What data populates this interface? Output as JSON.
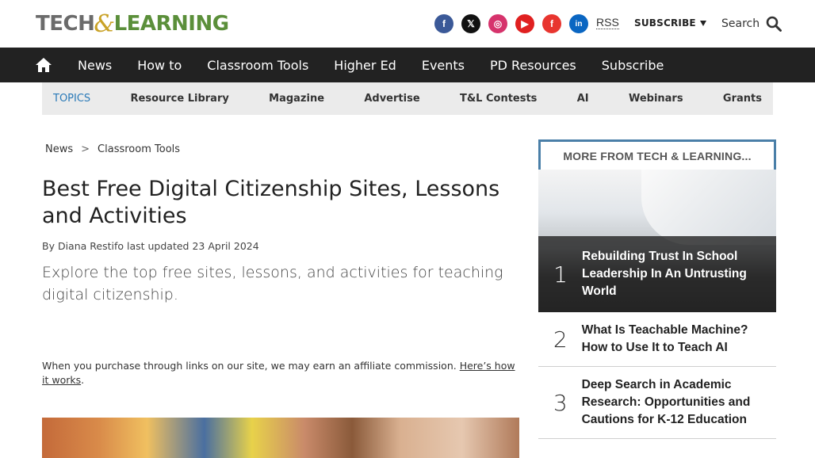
{
  "header": {
    "logo": {
      "part1": "TECH",
      "amp": "&",
      "part2": "LEARNING"
    },
    "social": [
      {
        "name": "facebook",
        "glyph": "f"
      },
      {
        "name": "x",
        "glyph": "𝕏"
      },
      {
        "name": "instagram",
        "glyph": "◎"
      },
      {
        "name": "youtube",
        "glyph": "▶"
      },
      {
        "name": "flipboard",
        "glyph": "f"
      },
      {
        "name": "linkedin",
        "glyph": "in"
      }
    ],
    "rss_label": "RSS",
    "subscribe_label": "SUBSCRIBE",
    "search_label": "Search"
  },
  "nav": {
    "items": [
      "News",
      "How to",
      "Classroom Tools",
      "Higher Ed",
      "Events",
      "PD Resources",
      "Subscribe"
    ]
  },
  "topics": {
    "label": "TOPICS",
    "items": [
      "Resource Library",
      "Magazine",
      "Advertise",
      "T&L Contests",
      "AI",
      "Webinars",
      "Grants"
    ]
  },
  "article": {
    "breadcrumb": {
      "first": "News",
      "sep": ">",
      "second": "Classroom Tools"
    },
    "title": "Best Free Digital Citizenship Sites, Lessons and Activities",
    "byline": "By Diana Restifo last updated 23 April 2024",
    "strapline": "Explore the top free sites, lessons, and activities for teaching digital citizenship.",
    "affiliate_text": "When you purchase through links on our site, we may earn an affiliate commission. ",
    "affiliate_link": "Here’s how it works",
    "affiliate_end": "."
  },
  "sidebar": {
    "heading": "MORE FROM TECH & LEARNING...",
    "items": [
      {
        "num": "1",
        "title": "Rebuilding Trust In School Leadership In An Untrusting World"
      },
      {
        "num": "2",
        "title": "What Is Teachable Machine? How to Use It to Teach AI"
      },
      {
        "num": "3",
        "title": "Deep Search in Academic Research: Opportunities and Cautions for K-12 Education"
      }
    ]
  },
  "colors": {
    "nav_bg": "#222222",
    "topics_bg": "#ebebeb",
    "topics_label": "#2a7ab8",
    "sidebar_border": "#4a7fa8",
    "logo_green": "#5b8f3a",
    "logo_gold": "#c9a227"
  }
}
